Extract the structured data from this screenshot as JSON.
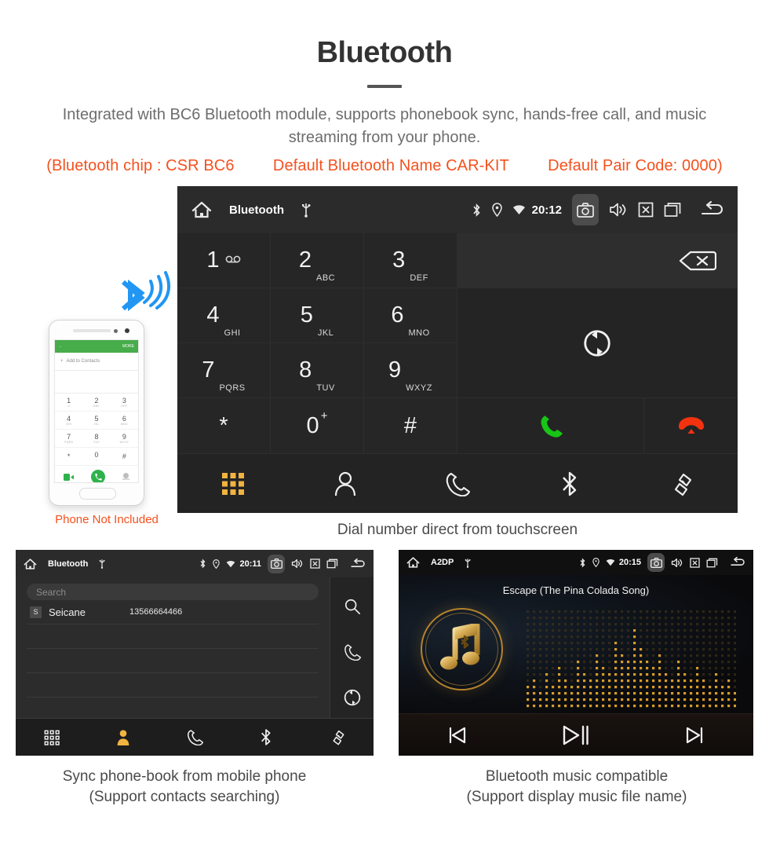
{
  "header": {
    "title": "Bluetooth",
    "subtitle": "Integrated with BC6 Bluetooth module, supports phonebook sync, hands-free call, and music streaming from your phone.",
    "spec_open": "(Bluetooth chip : CSR BC6",
    "spec_name": "Default Bluetooth Name CAR-KIT",
    "spec_code": "Default Pair Code: 0000)",
    "accent_color": "#f4511e",
    "text_color": "#6d6d6d"
  },
  "dialer": {
    "statusbar": {
      "home_icon": "home-icon",
      "title": "Bluetooth",
      "usb_icon": "usb-icon",
      "bluetooth_icon": "bluetooth-icon",
      "location_icon": "location-icon",
      "wifi_icon": "wifi-icon",
      "time": "20:12",
      "camera_icon": "camera-icon",
      "volume_icon": "volume-icon",
      "close_icon": "close-box-icon",
      "recents_icon": "recent-apps-icon",
      "back_icon": "back-icon"
    },
    "keys": [
      {
        "digit": "1",
        "sub": "",
        "voicemail": true
      },
      {
        "digit": "2",
        "sub": "ABC"
      },
      {
        "digit": "3",
        "sub": "DEF"
      },
      {
        "digit": "4",
        "sub": "GHI"
      },
      {
        "digit": "5",
        "sub": "JKL"
      },
      {
        "digit": "6",
        "sub": "MNO"
      },
      {
        "digit": "7",
        "sub": "PQRS"
      },
      {
        "digit": "8",
        "sub": "TUV"
      },
      {
        "digit": "9",
        "sub": "WXYZ"
      },
      {
        "digit": "*",
        "sub": ""
      },
      {
        "digit": "0",
        "sub": "",
        "plus": "+"
      },
      {
        "digit": "#",
        "sub": ""
      }
    ],
    "backspace_icon": "backspace-icon",
    "sync_icon": "sync-icon",
    "call_icon": "call-answer-icon",
    "hangup_icon": "call-end-icon",
    "nav": [
      {
        "icon": "dialpad-icon",
        "active": true
      },
      {
        "icon": "contacts-icon",
        "active": false
      },
      {
        "icon": "call-log-icon",
        "active": false
      },
      {
        "icon": "bluetooth-icon",
        "active": false
      },
      {
        "icon": "link-icon",
        "active": false
      }
    ],
    "active_color": "#f2b340"
  },
  "phonebook": {
    "statusbar": {
      "title": "Bluetooth",
      "time": "20:11"
    },
    "search_placeholder": "Search",
    "contacts": [
      {
        "initial": "S",
        "name": "Seicane",
        "number": "13566664466"
      }
    ],
    "empty_rows": 3,
    "side_icons": [
      "search-icon",
      "call-icon",
      "sync-icon"
    ],
    "nav": [
      {
        "icon": "dialpad-icon",
        "active": false
      },
      {
        "icon": "contacts-icon",
        "active": true
      },
      {
        "icon": "call-log-icon",
        "active": false
      },
      {
        "icon": "bluetooth-icon",
        "active": false
      },
      {
        "icon": "link-icon",
        "active": false
      }
    ]
  },
  "music": {
    "statusbar": {
      "title": "A2DP",
      "time": "20:15"
    },
    "song_title": "Escape (The Pina Colada Song)",
    "album_art_icon": "music-note-bluetooth-icon",
    "visualizer": "dot-matrix-equalizer",
    "controls": [
      {
        "icon": "previous-track-icon"
      },
      {
        "icon": "play-pause-icon"
      },
      {
        "icon": "next-track-icon"
      }
    ]
  },
  "phone_illustration": {
    "app_bar_back": "←",
    "app_bar_more": "MORE",
    "add_to_contacts": "Add to Contacts",
    "keys": [
      {
        "d": "1",
        "s": "∞"
      },
      {
        "d": "2",
        "s": "ABC"
      },
      {
        "d": "3",
        "s": "DEF"
      },
      {
        "d": "4",
        "s": "GHI"
      },
      {
        "d": "5",
        "s": "JKL"
      },
      {
        "d": "6",
        "s": "MNO"
      },
      {
        "d": "7",
        "s": "PQRS"
      },
      {
        "d": "8",
        "s": "TUV"
      },
      {
        "d": "9",
        "s": "WXYZ"
      },
      {
        "d": "*",
        "s": ""
      },
      {
        "d": "0",
        "s": "+"
      },
      {
        "d": "#",
        "s": ""
      }
    ],
    "caption": "Phone Not Included",
    "caption_color": "#f4511e",
    "bluetooth_signal_icon": "bluetooth-wireless-icon"
  },
  "captions": {
    "dialer": "Dial number direct from touchscreen",
    "phonebook_line1": "Sync phone-book from mobile phone",
    "phonebook_line2": "(Support contacts searching)",
    "music_line1": "Bluetooth music compatible",
    "music_line2": "(Support display music file name)"
  }
}
